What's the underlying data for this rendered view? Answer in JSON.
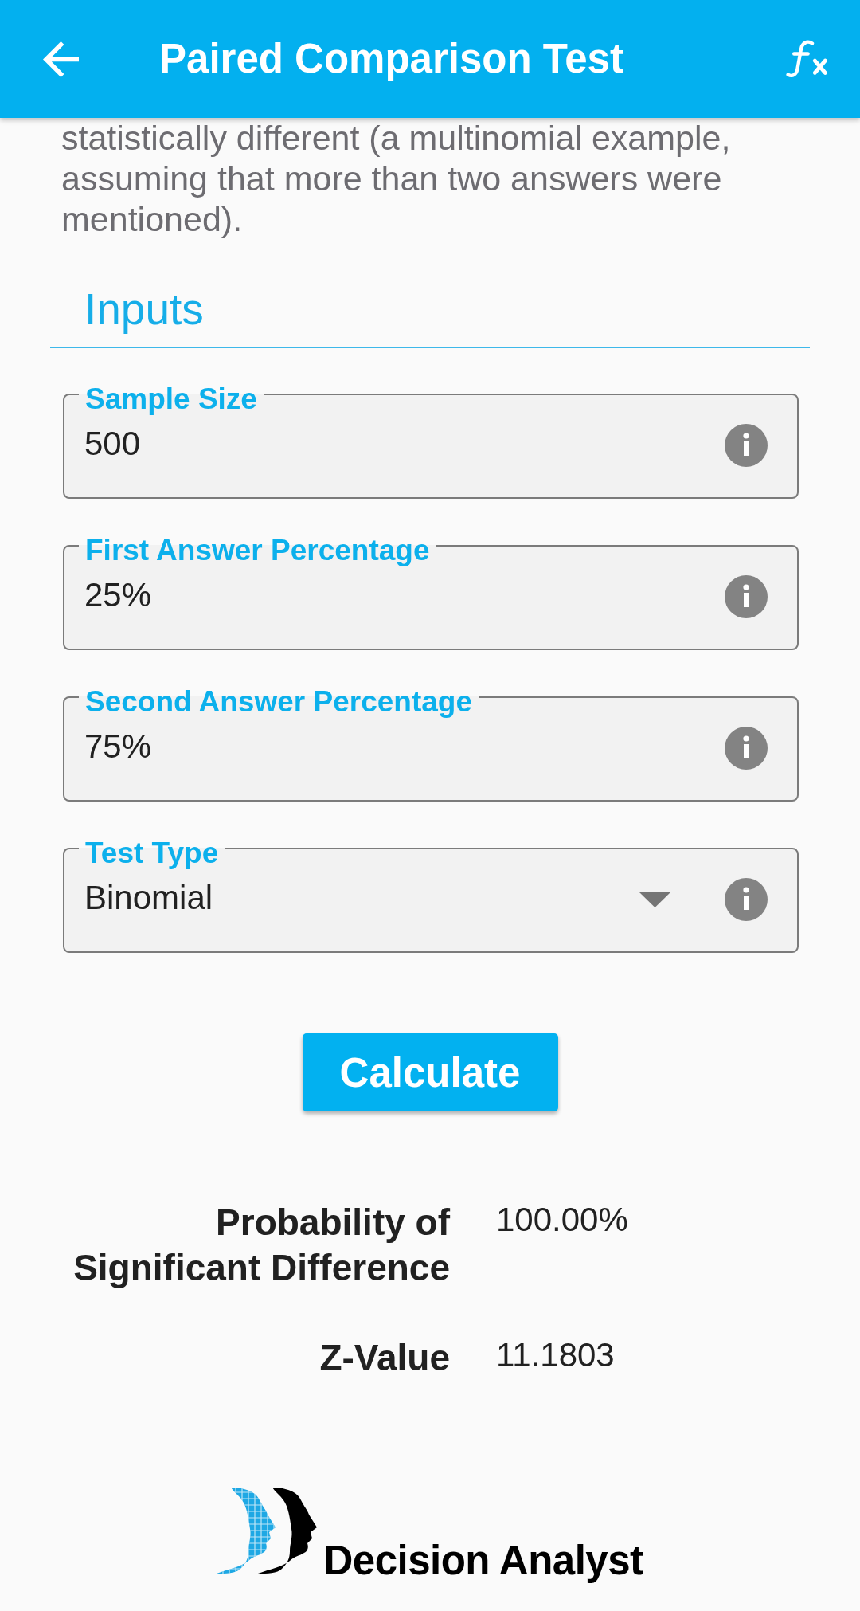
{
  "app_bar": {
    "title": "Paired Comparison Test"
  },
  "description": "statistically different (a multinomial example, assuming that more than two answers were mentioned).",
  "inputs": {
    "heading": "Inputs",
    "fields": [
      {
        "kind": "text",
        "label": "Sample Size",
        "value": "500"
      },
      {
        "kind": "text",
        "label": "First Answer Percentage",
        "value": "25%"
      },
      {
        "kind": "text",
        "label": "Second Answer Percentage",
        "value": "75%"
      },
      {
        "kind": "dropdown",
        "label": "Test Type",
        "value": "Binomial"
      }
    ]
  },
  "calculate_button": {
    "label": "Calculate"
  },
  "results": [
    {
      "label": "Probability of Significant Difference",
      "value": "100.00%"
    },
    {
      "label": "Z-Value",
      "value": "11.1803"
    }
  ],
  "logo": {
    "text": "Decision Analyst"
  }
}
